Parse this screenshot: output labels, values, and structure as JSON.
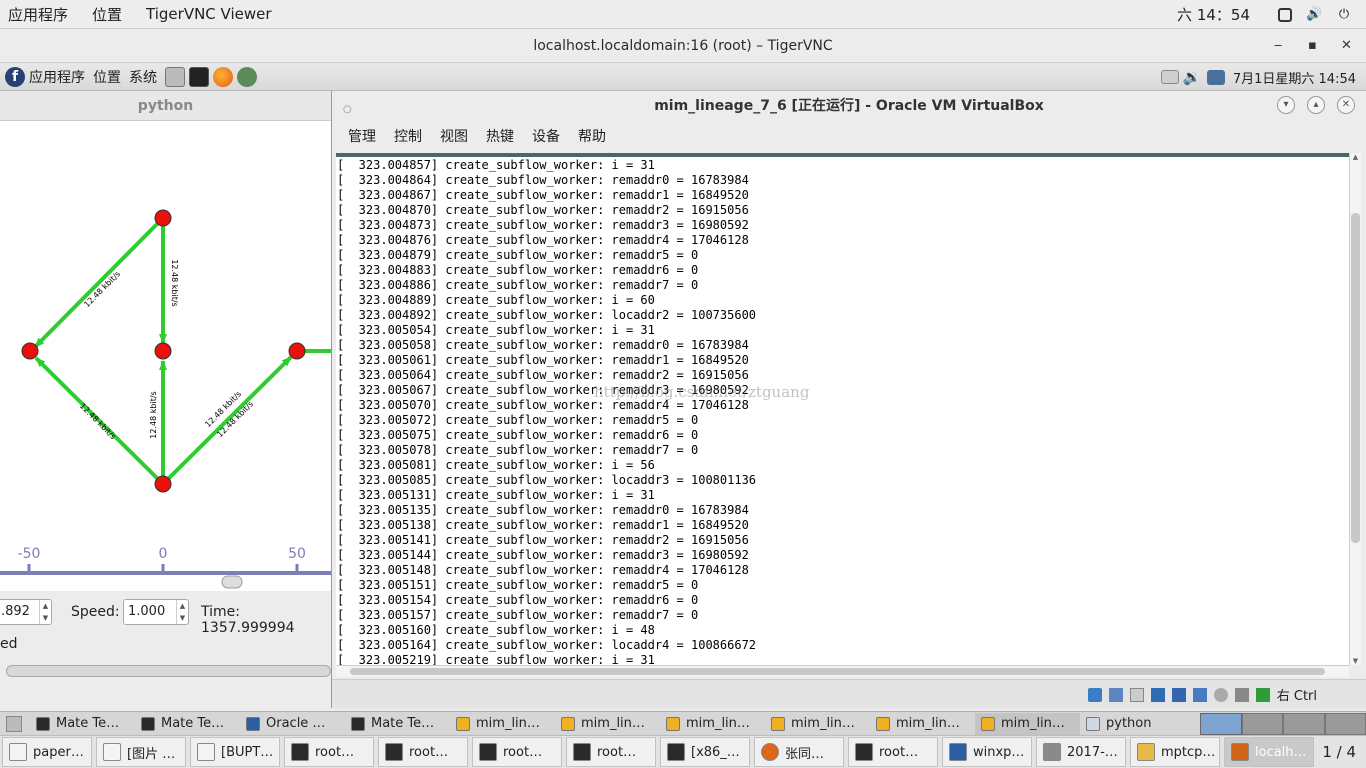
{
  "host_bar": {
    "apps_menu": "应用程序",
    "places_menu": "位置",
    "active_app": "TigerVNC Viewer",
    "clock": "六 14：54"
  },
  "vnc_window": {
    "title": "localhost.localdomain:16 (root) – TigerVNC",
    "min": "‒",
    "max": "▪",
    "close": "✕"
  },
  "guest_panel": {
    "apps_menu": "应用程序",
    "places_menu": "位置",
    "system_menu": "系统",
    "clock": "7月1日星期六 14:54"
  },
  "python_window": {
    "title": "python",
    "axis_ticks": [
      "-50",
      "0",
      "50"
    ],
    "link_labels": [
      "12.48 kbit/s",
      "12.48 kbit/s",
      "12.48 kbit/s",
      "12.48 kbit/s",
      "12.48 kbit/s",
      "12.48 kbit/s"
    ],
    "step_value": ".892",
    "speed_label": "Speed:",
    "speed_value": "1.000",
    "time_text": "Time: 1357.999994",
    "status_text": "ed"
  },
  "virtualbox": {
    "title": "mim_lineage_7_6 [正在运行] - Oracle VM VirtualBox",
    "menu": [
      "管理",
      "控制",
      "视图",
      "热键",
      "设备",
      "帮助"
    ],
    "host_key": "右 Ctrl",
    "watermark": "http://blog.csdn.net/ztguang",
    "console_lines": [
      "[  323.004857] create_subflow_worker: i = 31",
      "[  323.004864] create_subflow_worker: remaddr0 = 16783984",
      "[  323.004867] create_subflow_worker: remaddr1 = 16849520",
      "[  323.004870] create_subflow_worker: remaddr2 = 16915056",
      "[  323.004873] create_subflow_worker: remaddr3 = 16980592",
      "[  323.004876] create_subflow_worker: remaddr4 = 17046128",
      "[  323.004879] create_subflow_worker: remaddr5 = 0",
      "[  323.004883] create_subflow_worker: remaddr6 = 0",
      "[  323.004886] create_subflow_worker: remaddr7 = 0",
      "[  323.004889] create_subflow_worker: i = 60",
      "[  323.004892] create_subflow_worker: locaddr2 = 100735600",
      "[  323.005054] create_subflow_worker: i = 31",
      "[  323.005058] create_subflow_worker: remaddr0 = 16783984",
      "[  323.005061] create_subflow_worker: remaddr1 = 16849520",
      "[  323.005064] create_subflow_worker: remaddr2 = 16915056",
      "[  323.005067] create_subflow_worker: remaddr3 = 16980592",
      "[  323.005070] create_subflow_worker: remaddr4 = 17046128",
      "[  323.005072] create_subflow_worker: remaddr5 = 0",
      "[  323.005075] create_subflow_worker: remaddr6 = 0",
      "[  323.005078] create_subflow_worker: remaddr7 = 0",
      "[  323.005081] create_subflow_worker: i = 56",
      "[  323.005085] create_subflow_worker: locaddr3 = 100801136",
      "[  323.005131] create_subflow_worker: i = 31",
      "[  323.005135] create_subflow_worker: remaddr0 = 16783984",
      "[  323.005138] create_subflow_worker: remaddr1 = 16849520",
      "[  323.005141] create_subflow_worker: remaddr2 = 16915056",
      "[  323.005144] create_subflow_worker: remaddr3 = 16980592",
      "[  323.005148] create_subflow_worker: remaddr4 = 17046128",
      "[  323.005151] create_subflow_worker: remaddr5 = 0",
      "[  323.005154] create_subflow_worker: remaddr6 = 0",
      "[  323.005157] create_subflow_worker: remaddr7 = 0",
      "[  323.005160] create_subflow_worker: i = 48",
      "[  323.005164] create_subflow_worker: locaddr4 = 100866672",
      "[  323.005219] create_subflow_worker: i = 31"
    ]
  },
  "guest_taskbar": [
    {
      "label": "Mate Te…",
      "icon": "terminal-icon"
    },
    {
      "label": "Mate Te…",
      "icon": "terminal-icon"
    },
    {
      "label": "Oracle …",
      "icon": "virtualbox-icon"
    },
    {
      "label": "Mate Te…",
      "icon": "terminal-icon"
    },
    {
      "label": "mim_lin…",
      "icon": "vm-icon"
    },
    {
      "label": "mim_lin…",
      "icon": "vm-icon"
    },
    {
      "label": "mim_lin…",
      "icon": "vm-icon"
    },
    {
      "label": "mim_lin…",
      "icon": "vm-icon"
    },
    {
      "label": "mim_lin…",
      "icon": "vm-icon"
    },
    {
      "label": "mim_lin…",
      "icon": "vm-icon"
    },
    {
      "label": "python",
      "icon": "window-icon"
    }
  ],
  "host_taskbar": [
    {
      "label": "paper…",
      "icon": "document-icon"
    },
    {
      "label": "[图片 …",
      "icon": "document-icon"
    },
    {
      "label": "[BUPT…",
      "icon": "document-icon"
    },
    {
      "label": "root…",
      "icon": "terminal-icon"
    },
    {
      "label": "root…",
      "icon": "terminal-icon"
    },
    {
      "label": "root…",
      "icon": "terminal-icon"
    },
    {
      "label": "root…",
      "icon": "terminal-icon"
    },
    {
      "label": "[x86_…",
      "icon": "terminal-icon"
    },
    {
      "label": "张同…",
      "icon": "firefox-icon"
    },
    {
      "label": "root…",
      "icon": "terminal-icon"
    },
    {
      "label": "winxp…",
      "icon": "virtualbox-icon"
    },
    {
      "label": "2017-…",
      "icon": "image-viewer-icon"
    },
    {
      "label": "mptcp…",
      "icon": "editor-icon"
    },
    {
      "label": "localh…",
      "icon": "vnc-icon"
    }
  ],
  "workspace_indicator": "1 / 4"
}
